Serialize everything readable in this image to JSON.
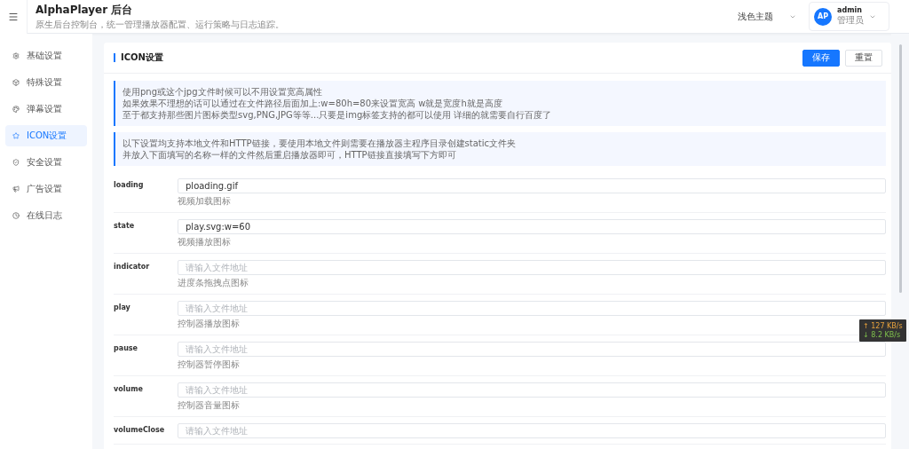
{
  "header": {
    "title": "AlphaPlayer 后台",
    "subtitle": "原生后台控制台，统一管理播放器配置、运行策略与日志追踪。",
    "theme_select": {
      "value": "浅色主题"
    },
    "user": {
      "avatar": "AP",
      "name": "admin",
      "role": "管理员"
    }
  },
  "sidebar": {
    "items": [
      {
        "label": "基础设置",
        "selected": false
      },
      {
        "label": "特殊设置",
        "selected": false
      },
      {
        "label": "弹幕设置",
        "selected": false
      },
      {
        "label": "ICON设置",
        "selected": true
      },
      {
        "label": "安全设置",
        "selected": false
      },
      {
        "label": "广告设置",
        "selected": false
      },
      {
        "label": "在线日志",
        "selected": false
      }
    ]
  },
  "card": {
    "title": "ICON设置",
    "buttons": [
      {
        "label": "保存",
        "kind": "primary"
      },
      {
        "label": "重置",
        "kind": "default"
      }
    ],
    "notices": [
      {
        "lines": [
          "使用png或这个jpg文件时候可以不用设置宽高属性",
          "如果效果不理想的话可以通过在文件路径后面加上:w=80h=80来设置宽高 w就是宽度h就是高度",
          "至于都支持那些图片图标类型svg,PNG,JPG等等...只要是img标签支持的都可以使用 详细的就需要自行百度了"
        ]
      },
      {
        "lines": [
          "以下设置均支持本地文件和HTTP链接，要使用本地文件则需要在播放器主程序目录创建static文件夹",
          "并放入下面填写的名称一样的文件然后重启播放器即可，HTTP链接直接填写下方即可"
        ]
      }
    ],
    "fields": [
      {
        "label": "loading",
        "value": "ploading.gif",
        "hint": "视频加载图标"
      },
      {
        "label": "state",
        "value": "play.svg:w=60",
        "hint": "视频播放图标"
      },
      {
        "label": "indicator",
        "placeholder": "请输入文件地址",
        "hint": "进度条拖拽点图标"
      },
      {
        "label": "play",
        "placeholder": "请输入文件地址",
        "hint": "控制器播放图标"
      },
      {
        "label": "pause",
        "placeholder": "请输入文件地址",
        "hint": "控制器暂停图标"
      },
      {
        "label": "volume",
        "placeholder": "请输入文件地址",
        "hint": "控制器音量图标"
      },
      {
        "label": "volumeClose",
        "placeholder": "请输入文件地址"
      }
    ]
  },
  "net_speed": {
    "up": "↑ 127 KB/s",
    "down": "↓ 8.2 KB/s"
  }
}
